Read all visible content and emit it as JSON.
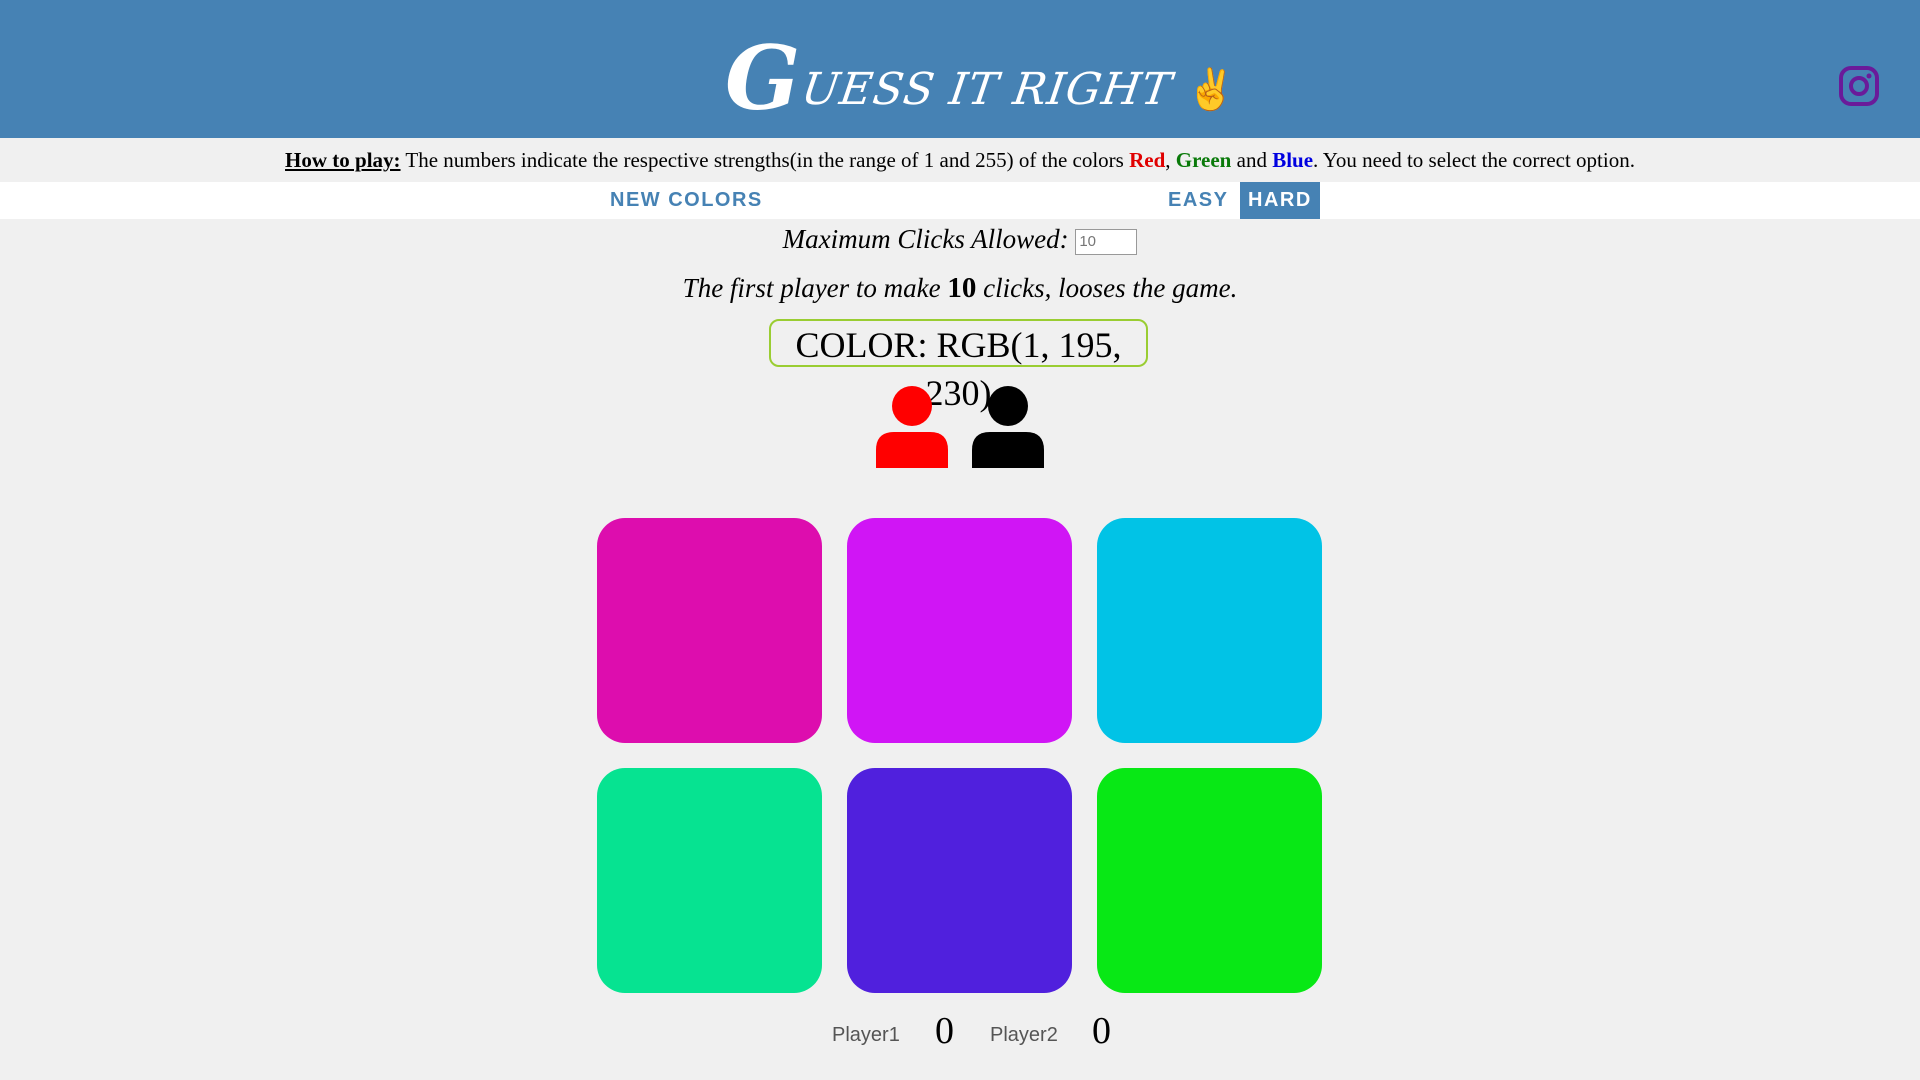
{
  "header": {
    "title_first": "G",
    "title_rest": "UESS IT RIGHT",
    "title_icon": "✌",
    "instagram_icon": "instagram-icon",
    "bg_color": "#4682b4"
  },
  "howto": {
    "label": "How to play:",
    "text1": " The numbers indicate the respective strengths(in the range of 1 and 255) of the colors ",
    "red": "Red",
    "sep1": ", ",
    "green": "Green",
    "sep2": " and ",
    "blue": "Blue",
    "text2": ". You need to select the correct option."
  },
  "nav": {
    "new_colors": "NEW COLORS",
    "easy": "EASY",
    "hard": "HARD",
    "active_mode": "HARD"
  },
  "game": {
    "max_clicks_label": "Maximum Clicks Allowed:",
    "max_clicks_placeholder": "10",
    "rule_pre": "The first player to make ",
    "rule_num": "10",
    "rule_post": " clicks, looses the game.",
    "color_display": "COLOR: RGB(1, 195, 230)"
  },
  "players": [
    {
      "name": "Player1",
      "score": "0",
      "icon_color": "#ff0000",
      "icon": "user-icon"
    },
    {
      "name": "Player2",
      "score": "0",
      "icon_color": "#000000",
      "icon": "user-icon"
    }
  ],
  "squares": [
    "#dd0dae",
    "#d015f5",
    "#01c3e6",
    "#06e391",
    "#5020dd",
    "#08e815"
  ]
}
